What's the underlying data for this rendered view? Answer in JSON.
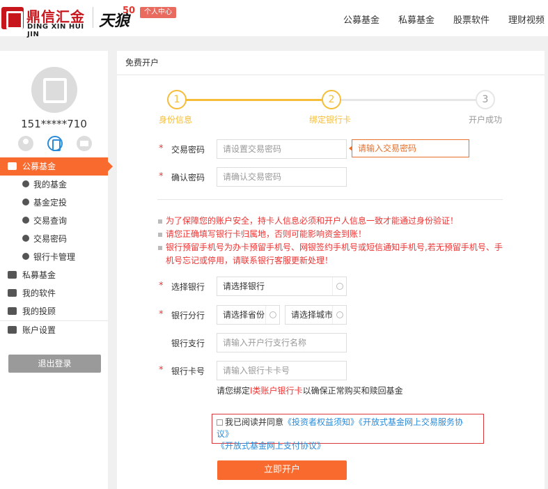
{
  "header": {
    "logo_cn": "鼎信汇金",
    "logo_en": "DING XIN HUI JIN",
    "brand2": "天狼",
    "brand2_badge": "50",
    "user_center": "个人中心",
    "nav": [
      "公募基金",
      "私募基金",
      "股票软件",
      "理财视频"
    ]
  },
  "sidebar": {
    "phone": "151*****710",
    "menu": [
      {
        "label": "公募基金",
        "icon": "wallet-icon",
        "active": true
      },
      {
        "label": "我的基金",
        "icon": "user-circle-icon",
        "sub": true
      },
      {
        "label": "基金定投",
        "icon": "export-icon",
        "sub": true
      },
      {
        "label": "交易查询",
        "icon": "search-doc-icon",
        "sub": true
      },
      {
        "label": "交易密码",
        "icon": "key-icon",
        "sub": true
      },
      {
        "label": "银行卡管理",
        "icon": "card-icon",
        "sub": true
      },
      {
        "label": "私募基金",
        "icon": "money-icon"
      },
      {
        "label": "我的软件",
        "icon": "chart-icon"
      },
      {
        "label": "我的投顾",
        "icon": "pie-icon"
      },
      {
        "label": "账户设置",
        "icon": "id-card-icon"
      }
    ],
    "logout": "退出登录"
  },
  "main": {
    "breadcrumb": "免费开户",
    "steps": [
      {
        "num": "1",
        "label": "身份信息"
      },
      {
        "num": "2",
        "label": "绑定银行卡"
      },
      {
        "num": "3",
        "label": "开户成功"
      }
    ],
    "fields": {
      "trade_pwd_label": "交易密码",
      "trade_pwd_placeholder": "请设置交易密码",
      "trade_pwd_error": "请输入交易密码",
      "confirm_pwd_label": "确认密码",
      "confirm_pwd_placeholder": "请确认交易密码",
      "bank_label": "选择银行",
      "bank_value": "请选择银行",
      "branch_label": "银行分行",
      "province_value": "请选择省份",
      "city_value": "请选择城市",
      "subbranch_label": "银行支行",
      "subbranch_placeholder": "请输入开户行支行名称",
      "card_label": "银行卡号",
      "card_placeholder": "请输入银行卡卡号"
    },
    "notes": [
      "为了保障您的账户安全，持卡人信息必须和开户人信息一致才能通过身份验证！",
      "请您正确填写银行卡归属地，否则可能影响资金到账！",
      "银行预留手机号为办卡预留手机号、网银签约手机号或短信通知手机号,若无预留手机号、手机号忘记或停用，请联系银行客服更新处理！"
    ],
    "tip_prefix": "请您绑定",
    "tip_highlight": "I类账户银行卡",
    "tip_suffix": "以确保正常购买和赎回基金",
    "agree_text": "我已阅读并同意",
    "agree_links": [
      "《投资者权益须知》",
      "《开放式基金网上交易服务协议》",
      "《开放式基金网上支付协议》"
    ],
    "submit": "立即开户"
  }
}
